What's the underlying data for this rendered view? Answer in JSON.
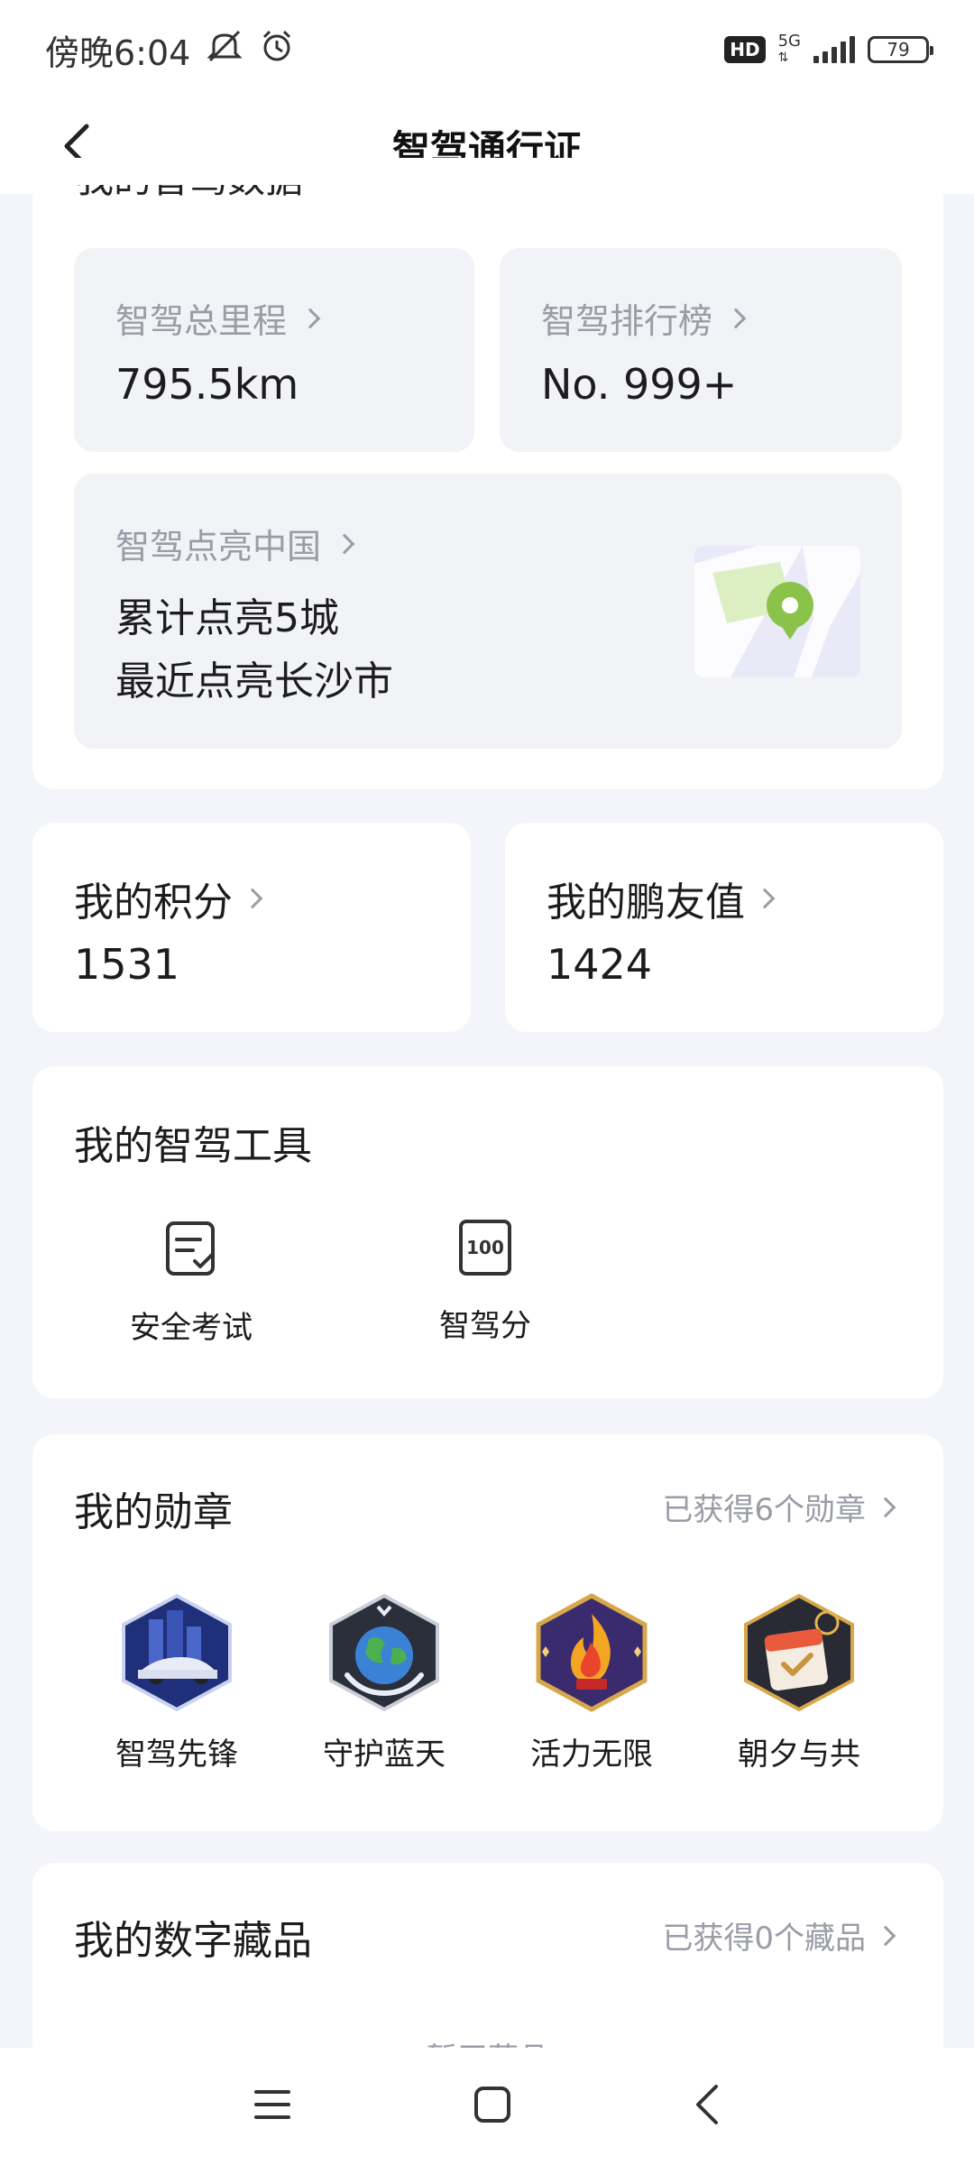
{
  "status_bar": {
    "time": "傍晚6:04",
    "hd": "HD",
    "network": "5G",
    "battery": "79"
  },
  "nav": {
    "title": "智驾通行证"
  },
  "my_data": {
    "section_title": "我的智驾数据",
    "mileage": {
      "label": "智驾总里程",
      "value": "795.5km"
    },
    "ranking": {
      "label": "智驾排行榜",
      "value": "No. 999+"
    },
    "cities": {
      "label": "智驾点亮中国",
      "line1": "累计点亮5城",
      "line2": "最近点亮长沙市"
    }
  },
  "points": {
    "label": "我的积分",
    "value": "1531"
  },
  "friend_value": {
    "label": "我的鹏友值",
    "value": "1424"
  },
  "tools": {
    "title": "我的智驾工具",
    "items": [
      {
        "label": "安全考试",
        "icon": "exam-clipboard-icon"
      },
      {
        "label": "智驾分",
        "icon": "score-100-icon",
        "icon_text": "100"
      }
    ]
  },
  "medals": {
    "title": "我的勋章",
    "link": "已获得6个勋章",
    "items": [
      {
        "label": "智驾先锋",
        "icon": "car-pioneer-badge"
      },
      {
        "label": "守护蓝天",
        "icon": "earth-guardian-badge"
      },
      {
        "label": "活力无限",
        "icon": "flame-badge"
      },
      {
        "label": "朝夕与共",
        "icon": "calendar-badge"
      }
    ]
  },
  "collectibles": {
    "title": "我的数字藏品",
    "link": "已获得0个藏品",
    "empty": "暂无藏品"
  },
  "colors": {
    "accent_green": "#8bc34a",
    "card_bg": "#ffffff",
    "tile_bg": "#f2f3f7",
    "muted_text": "#9a9ca6"
  }
}
